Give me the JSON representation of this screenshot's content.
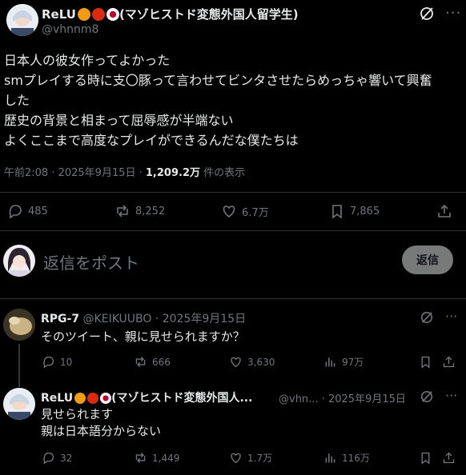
{
  "main_post": {
    "author_name": "ReLU",
    "author_suffix": "(マゾヒストド変態外国人留学生)",
    "handle": "@vhnnm8",
    "text_lines": [
      "日本人の彼女作ってよかった",
      "smプレイする時に支〇豚って言わせてビンタさせたらめっちゃ響いて興奮",
      "した",
      "歴史の背景と相まって屈辱感が半端ない",
      "よくここまで高度なプレイができるんだな僕たちは"
    ],
    "meta_time": "午前2:08 · 2025年9月15日 · ",
    "meta_views": "1,209.2万",
    "meta_views_label": " 件の表示",
    "stats": {
      "replies": "485",
      "reposts": "8,252",
      "likes": "6.7万",
      "bookmarks": "7,865"
    }
  },
  "reply_box": {
    "placeholder": "返信をポスト",
    "button_label": "返信"
  },
  "replies": [
    {
      "author_name": "RPG-7",
      "handle": "@KEIKUUBO",
      "date": "· 2025年9月15日",
      "text_lines": [
        "そのツイート、親に見せられますか？"
      ],
      "stats": {
        "replies": "10",
        "reposts": "666",
        "likes": "3,630",
        "views": "97万"
      }
    },
    {
      "author_name": "ReLU",
      "author_suffix": "(マゾヒストド変態外国人...",
      "handle": "@vhn...",
      "date": "· 2025年9月15日",
      "text_lines": [
        "見せられます",
        "親は日本語分からない"
      ],
      "stats": {
        "replies": "32",
        "reposts": "1,449",
        "likes": "1.7万",
        "views": "116万"
      }
    }
  ],
  "colors": {
    "background": "#000000",
    "text": "#e7e9ea",
    "muted": "#71767b",
    "divider": "#2f3336"
  }
}
